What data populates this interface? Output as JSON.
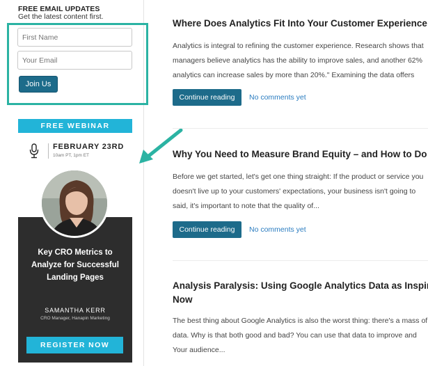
{
  "sidebar": {
    "email_heading": "FREE EMAIL UPDATES",
    "email_sub": "Get the latest content first.",
    "first_name_placeholder": "First Name",
    "email_placeholder": "Your Email",
    "join_label": "Join Us"
  },
  "webinar": {
    "banner": "FREE WEBINAR",
    "date": "FEBRUARY 23RD",
    "time": "10am PT, 1pm ET",
    "title": "Key CRO Metrics to Analyze for Successful Landing Pages",
    "speaker": "SAMANTHA KERR",
    "speaker_role": "CRO Manager, Hanapin Marketing",
    "register_label": "REGISTER NOW"
  },
  "posts": [
    {
      "title": "Where Does Analytics Fit Into Your Customer Experience",
      "excerpt_lines": [
        "Analytics is integral to refining the customer experience. Research shows that",
        "managers believe analytics has the ability to improve sales, and another 62%",
        "analytics can increase sales by more than 20%.\" Examining the data offers"
      ],
      "continue_label": "Continue reading",
      "comments_label": "No comments yet"
    },
    {
      "title": "Why You Need to Measure Brand Equity – and How to Do It",
      "excerpt_lines": [
        "Before we get started, let's get one thing straight: If the product or service you",
        "doesn't live up to your customers' expectations, your business isn't going to",
        "said, it's important to note that the quality of..."
      ],
      "continue_label": "Continue reading",
      "comments_label": "No comments yet"
    },
    {
      "title_lines": [
        "Analysis Paralysis: Using Google Analytics Data as Inspiration",
        "Now"
      ],
      "excerpt_lines": [
        "The best thing about Google Analytics is also the worst thing: there's a mass of",
        "data. Why is that both good and bad? You can use that data to improve and",
        "Your audience..."
      ]
    }
  ],
  "colors": {
    "accent_teal": "#2bb3a3",
    "button_blue": "#1d6b8a",
    "webinar_cyan": "#22b4d8",
    "link_blue": "#2a7cc0"
  }
}
